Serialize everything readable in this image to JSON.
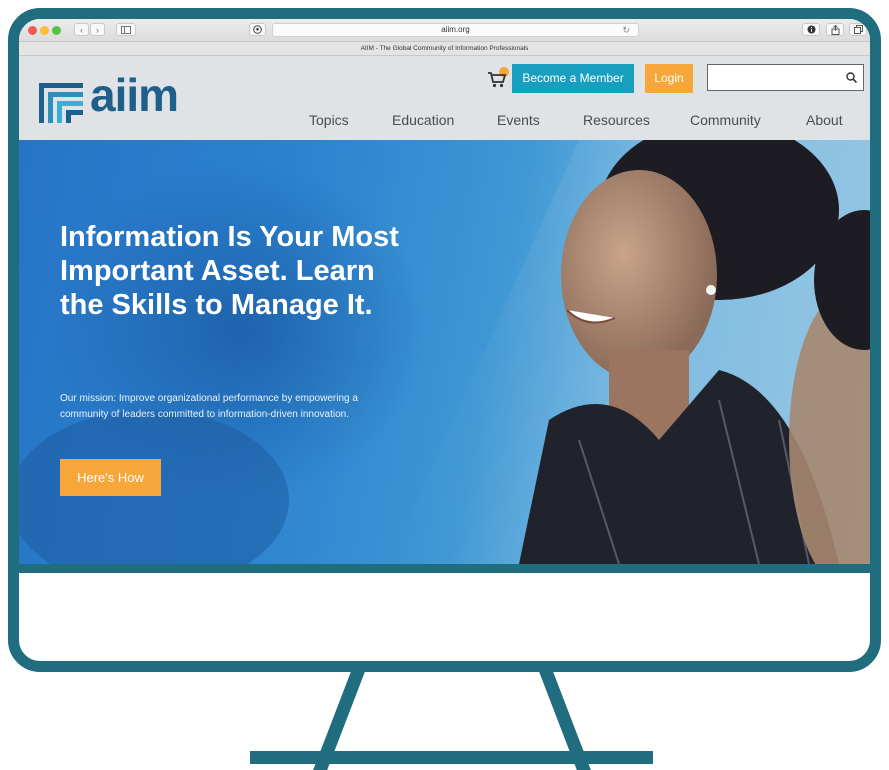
{
  "browser": {
    "url": "aiim.org",
    "tab_title": "AIIM - The Global Community of Information Professionals",
    "nav_back_glyph": "‹",
    "nav_forward_glyph": "›",
    "reload_glyph": "↻"
  },
  "header": {
    "logo_text": "aiim",
    "member_button_label": "Become a Member",
    "login_button_label": "Login",
    "search_value": "",
    "search_placeholder": ""
  },
  "nav": {
    "items": [
      {
        "label": "Topics"
      },
      {
        "label": "Education"
      },
      {
        "label": "Events"
      },
      {
        "label": "Resources"
      },
      {
        "label": "Community"
      },
      {
        "label": "About"
      }
    ]
  },
  "hero": {
    "title": "Information Is Your Most Important Asset. Learn the Skills to Manage It.",
    "mission": "Our mission:  Improve organizational performance by empowering a community of leaders committed to information-driven innovation.",
    "cta_label": "Here's How"
  },
  "colors": {
    "frame": "#1f6d7f",
    "brand_blue": "#1e5f8c",
    "member_button": "#189fc0",
    "accent_orange": "#f7a63a"
  },
  "icons": {
    "cart": "cart-icon",
    "search": "search-icon",
    "info": "info-icon",
    "share": "share-icon",
    "tabs": "tabs-icon",
    "pinterest": "pinterest-icon",
    "sidebar": "sidebar-icon"
  }
}
